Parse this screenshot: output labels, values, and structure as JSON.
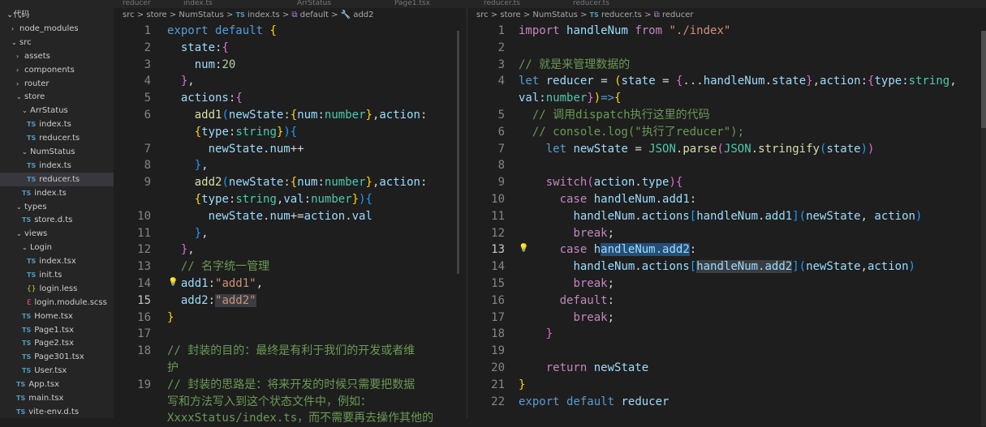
{
  "explorer": {
    "title": "代码"
  },
  "tree": [
    {
      "label": "node_modules",
      "indent": 14,
      "kind": "folder",
      "open": false
    },
    {
      "label": "src",
      "indent": 14,
      "kind": "folder",
      "open": true
    },
    {
      "label": "assets",
      "indent": 20,
      "kind": "folder",
      "open": false
    },
    {
      "label": "components",
      "indent": 20,
      "kind": "folder",
      "open": false
    },
    {
      "label": "router",
      "indent": 20,
      "kind": "folder",
      "open": false
    },
    {
      "label": "store",
      "indent": 20,
      "kind": "folder",
      "open": true
    },
    {
      "label": "ArrStatus",
      "indent": 27,
      "kind": "folder",
      "open": true
    },
    {
      "label": "index.ts",
      "indent": 33,
      "kind": "ts"
    },
    {
      "label": "reducer.ts",
      "indent": 33,
      "kind": "ts"
    },
    {
      "label": "NumStatus",
      "indent": 27,
      "kind": "folder",
      "open": true
    },
    {
      "label": "index.ts",
      "indent": 33,
      "kind": "ts"
    },
    {
      "label": "reducer.ts",
      "indent": 33,
      "kind": "ts",
      "active": true
    },
    {
      "label": "index.ts",
      "indent": 27,
      "kind": "ts"
    },
    {
      "label": "types",
      "indent": 20,
      "kind": "folder",
      "open": true
    },
    {
      "label": "store.d.ts",
      "indent": 27,
      "kind": "ts"
    },
    {
      "label": "views",
      "indent": 20,
      "kind": "folder",
      "open": true
    },
    {
      "label": "Login",
      "indent": 27,
      "kind": "folder",
      "open": true
    },
    {
      "label": "index.tsx",
      "indent": 33,
      "kind": "ts"
    },
    {
      "label": "init.ts",
      "indent": 33,
      "kind": "ts"
    },
    {
      "label": "login.less",
      "indent": 33,
      "kind": "less"
    },
    {
      "label": "login.module.scss",
      "indent": 33,
      "kind": "scss"
    },
    {
      "label": "Home.tsx",
      "indent": 27,
      "kind": "ts"
    },
    {
      "label": "Page1.tsx",
      "indent": 27,
      "kind": "ts"
    },
    {
      "label": "Page2.tsx",
      "indent": 27,
      "kind": "ts"
    },
    {
      "label": "Page301.tsx",
      "indent": 27,
      "kind": "ts"
    },
    {
      "label": "User.tsx",
      "indent": 27,
      "kind": "ts"
    },
    {
      "label": "App.tsx",
      "indent": 20,
      "kind": "ts"
    },
    {
      "label": "main.tsx",
      "indent": 20,
      "kind": "ts"
    },
    {
      "label": "vite-env.d.ts",
      "indent": 20,
      "kind": "ts"
    }
  ],
  "tabs": {
    "t1": "reducer",
    "t2": "index.ts",
    "t3": "ArrStatus",
    "t4": "Page1.tsx",
    "t5": "reducer.ts",
    "t6": "reducer.ts"
  },
  "left_breadcrumb": {
    "src": "src",
    "store": "store",
    "numstatus": "NumStatus",
    "file_badge": "TS",
    "file": "index.ts",
    "sym1": "default",
    "sym2": "add2"
  },
  "right_breadcrumb": {
    "src": "src",
    "store": "store",
    "numstatus": "NumStatus",
    "file_badge": "TS",
    "file": "reducer.ts",
    "sym1": "reducer"
  },
  "left_code": [
    {
      "n": "1",
      "html": "<span class='k'>export</span> <span class='k'>default</span> <span class='b1'>{</span>"
    },
    {
      "n": "2",
      "html": "  <span class='v'>state</span><span class='o'>:</span><span class='b2'>{</span>"
    },
    {
      "n": "3",
      "html": "    <span class='v'>num</span><span class='o'>:</span><span class='n'>20</span>"
    },
    {
      "n": "4",
      "html": "  <span class='b2'>}</span><span class='o'>,</span>"
    },
    {
      "n": "5",
      "html": "  <span class='v'>actions</span><span class='o'>:</span><span class='b2'>{</span>"
    },
    {
      "n": "6",
      "html": "    <span class='f'>add1</span><span class='b3'>(</span><span class='v'>newState</span><span class='o'>:</span><span class='b1'>{</span><span class='v'>num</span><span class='o'>:</span><span class='t'>number</span><span class='b1'>}</span><span class='o'>,</span><span class='v'>action</span><span class='o'>:</span>"
    },
    {
      "n": "",
      "html": "    <span class='b1'>{</span><span class='v'>type</span><span class='o'>:</span><span class='t'>string</span><span class='b1'>}</span><span class='b3'>)</span><span class='b3'>{</span>"
    },
    {
      "n": "7",
      "html": "      <span class='v'>newState</span><span class='o'>.</span><span class='v'>num</span><span class='o'>++</span>"
    },
    {
      "n": "8",
      "html": "    <span class='b3'>}</span><span class='o'>,</span>"
    },
    {
      "n": "9",
      "html": "    <span class='f'>add2</span><span class='b3'>(</span><span class='v'>newState</span><span class='o'>:</span><span class='b1'>{</span><span class='v'>num</span><span class='o'>:</span><span class='t'>number</span><span class='b1'>}</span><span class='o'>,</span><span class='v'>action</span><span class='o'>:</span>"
    },
    {
      "n": "",
      "html": "    <span class='b1'>{</span><span class='v'>type</span><span class='o'>:</span><span class='t'>string</span><span class='o'>,</span><span class='v'>val</span><span class='o'>:</span><span class='t'>number</span><span class='b1'>}</span><span class='b3'>)</span><span class='b3'>{</span>"
    },
    {
      "n": "10",
      "html": "      <span class='v'>newState</span><span class='o'>.</span><span class='v'>num</span><span class='o'>+=</span><span class='v'>action</span><span class='o'>.</span><span class='v'>val</span>"
    },
    {
      "n": "11",
      "html": "    <span class='b3'>}</span><span class='o'>,</span>"
    },
    {
      "n": "12",
      "html": "  <span class='b2'>}</span><span class='o'>,</span>"
    },
    {
      "n": "13",
      "html": "  <span class='cm'>// 名字统一管理</span>"
    },
    {
      "n": "14",
      "html": "  <span class='v'>add1</span><span class='o'>:</span><span class='s'>\"add1\"</span><span class='o'>,</span>",
      "bulb": true
    },
    {
      "n": "15",
      "html": "  <span class='v'>add2</span><span class='o'>:</span><span class='s hl2'>\"add2\"</span>",
      "cur": true
    },
    {
      "n": "16",
      "html": "<span class='b1'>}</span>"
    },
    {
      "n": "17",
      "html": ""
    },
    {
      "n": "18",
      "html": "<span class='cm'>// 封装的目的：最终是有利于我们的开发或者维</span>"
    },
    {
      "n": "",
      "html": "<span class='cm'>护</span>"
    },
    {
      "n": "19",
      "html": "<span class='cm'>// 封装的思路是：将来开发的时候只需要把数据</span>"
    },
    {
      "n": "",
      "html": "<span class='cm'>写和方法写入到这个状态文件中，例如：</span>"
    },
    {
      "n": "",
      "html": "<span class='cm'>XxxxStatus/index.ts，而不需要再去操作其他的</span>"
    }
  ],
  "right_code": [
    {
      "n": "1",
      "html": "<span class='c'>import</span> <span class='v'>handleNum</span> <span class='c'>from</span> <span class='s'>\"./index\"</span>"
    },
    {
      "n": "2",
      "html": ""
    },
    {
      "n": "3",
      "html": "<span class='cm'>// 就是来管理数据的</span>"
    },
    {
      "n": "4",
      "html": "<span class='k'>let</span> <span class='v'>reducer</span> <span class='o'>=</span> <span class='b1'>(</span><span class='v'>state</span> <span class='o'>=</span> <span class='b2'>{</span><span class='o'>...</span><span class='v'>handleNum</span><span class='o'>.</span><span class='v'>state</span><span class='b2'>}</span><span class='o'>,</span><span class='v'>action</span><span class='o'>:</span><span class='b2'>{</span><span class='v'>type</span><span class='o'>:</span><span class='t'>string</span><span class='o'>,</span>"
    },
    {
      "n": "",
      "html": "<span class='v'>val</span><span class='o'>:</span><span class='t'>number</span><span class='b2'>}</span><span class='b1'>)</span><span class='k'>=></span><span class='b1'>{</span>"
    },
    {
      "n": "5",
      "html": "  <span class='cm'>// 调用dispatch执行这里的代码</span>"
    },
    {
      "n": "6",
      "html": "  <span class='cm'>// console.log(\"执行了reducer\");</span>"
    },
    {
      "n": "7",
      "html": "    <span class='k'>let</span> <span class='v'>newState</span> <span class='o'>=</span> <span class='t'>JSON</span><span class='o'>.</span><span class='f'>parse</span><span class='b2'>(</span><span class='t'>JSON</span><span class='o'>.</span><span class='f'>stringify</span><span class='b3'>(</span><span class='v'>state</span><span class='b3'>)</span><span class='b2'>)</span>"
    },
    {
      "n": "8",
      "html": ""
    },
    {
      "n": "9",
      "html": "    <span class='c'>switch</span><span class='b2'>(</span><span class='v'>action</span><span class='o'>.</span><span class='v'>type</span><span class='b2'>)</span><span class='b2'>{</span>"
    },
    {
      "n": "10",
      "html": "      <span class='c'>case</span> <span class='v'>handleNum</span><span class='o'>.</span><span class='v'>add1</span><span class='o'>:</span>"
    },
    {
      "n": "11",
      "html": "        <span class='v'>handleNum</span><span class='o'>.</span><span class='v'>actions</span><span class='b3'>[</span><span class='v'>handleNum</span><span class='o'>.</span><span class='v'>add1</span><span class='b3'>]</span><span class='b3'>(</span><span class='v'>newState</span><span class='o'>,</span> <span class='v'>action</span><span class='b3'>)</span>"
    },
    {
      "n": "12",
      "html": "        <span class='c'>break</span><span class='o'>;</span>"
    },
    {
      "n": "13",
      "html": "      <span class='c'>case</span> <span class='v'>h<span class='hl'>andleNum.add2</span></span><span class='o'>:</span>",
      "bulb": true,
      "cur": true
    },
    {
      "n": "14",
      "html": "        <span class='v'>handleNum</span><span class='o'>.</span><span class='v'>actions</span><span class='b3'>[</span><span class='v hl2'>handleNum.add2</span><span class='b3'>]</span><span class='b3'>(</span><span class='v'>newState</span><span class='o'>,</span><span class='v'>action</span><span class='b3'>)</span>"
    },
    {
      "n": "15",
      "html": "        <span class='c'>break</span><span class='o'>;</span>"
    },
    {
      "n": "16",
      "html": "      <span class='c'>default</span><span class='o'>:</span>"
    },
    {
      "n": "17",
      "html": "        <span class='c'>break</span><span class='o'>;</span>"
    },
    {
      "n": "18",
      "html": "    <span class='b2'>}</span>"
    },
    {
      "n": "19",
      "html": ""
    },
    {
      "n": "20",
      "html": "    <span class='c'>return</span> <span class='v'>newState</span>"
    },
    {
      "n": "21",
      "html": "<span class='b1'>}</span>"
    },
    {
      "n": "22",
      "html": "<span class='k'>export</span> <span class='k'>default</span> <span class='v'>reducer</span>"
    }
  ]
}
